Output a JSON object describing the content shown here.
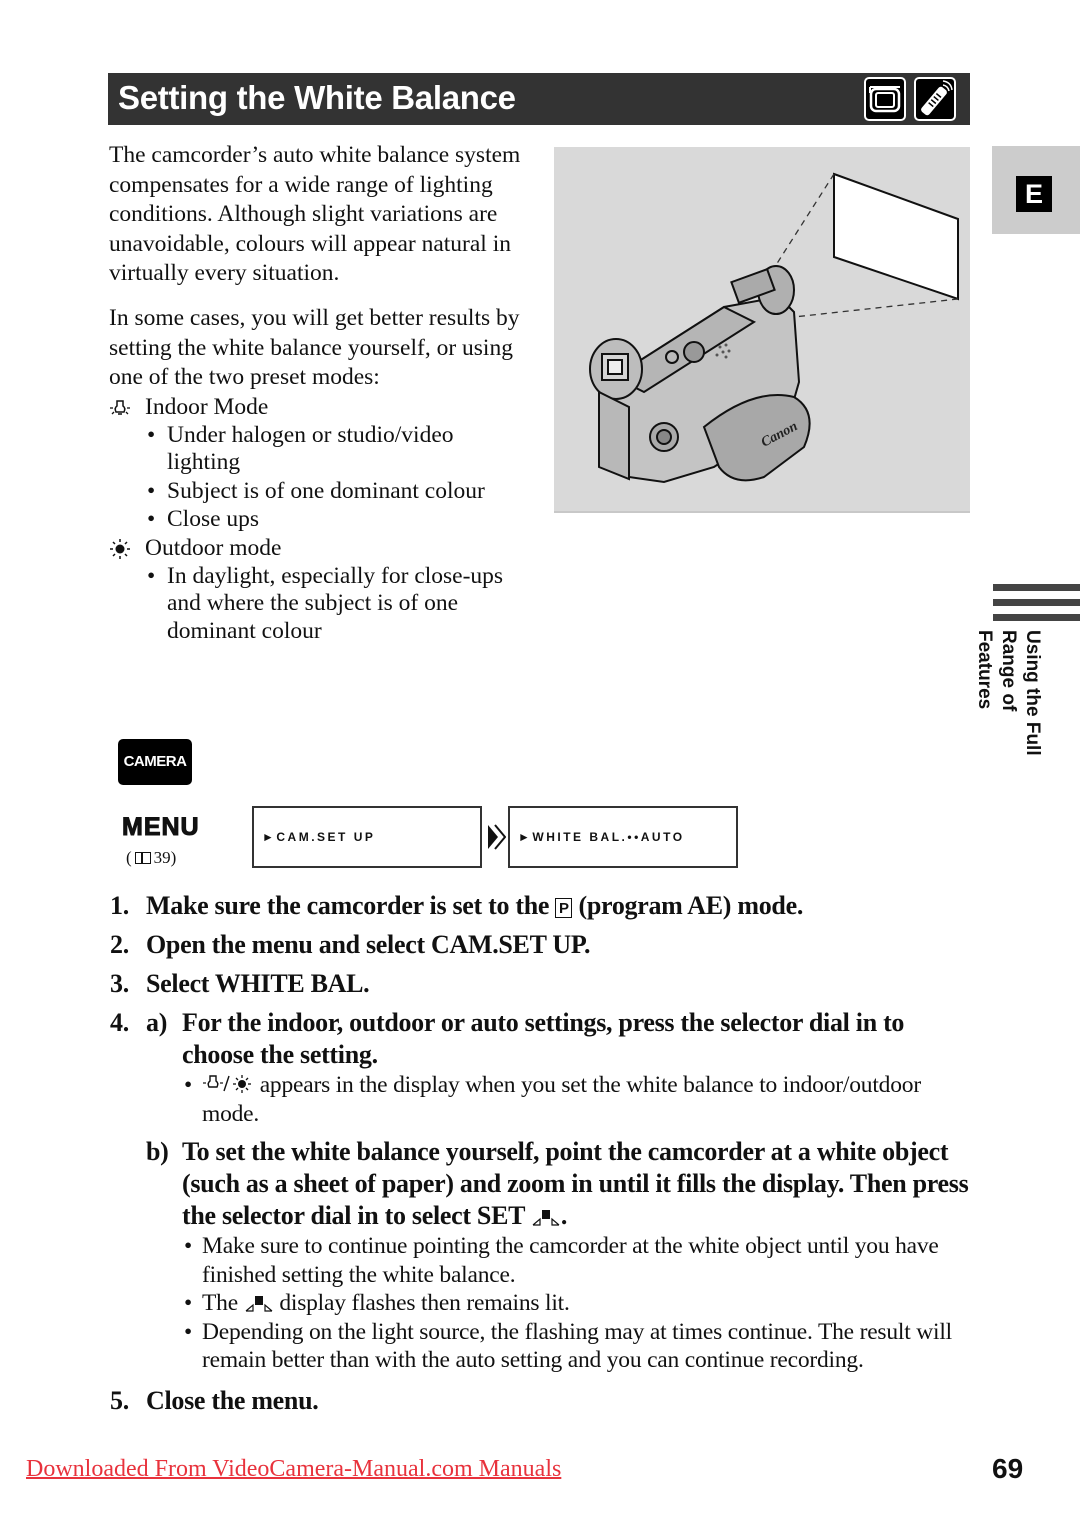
{
  "header": {
    "title": "Setting the White Balance",
    "icons": [
      "camcorder-icon",
      "remote-control-icon"
    ]
  },
  "intro": {
    "paragraph1": "The camcorder’s auto white balance system compensates for a wide range of lighting conditions. Although slight variations are unavoidable, colours will appear natural in virtually every situation.",
    "paragraph2": "In some cases, you will get better results by setting the white balance yourself, or using one of the two preset modes:",
    "modes": [
      {
        "icon": "indoor-bulb-icon",
        "label": "Indoor Mode",
        "items": [
          "Under halogen or studio/video lighting",
          "Subject is of one dominant colour",
          "Close ups"
        ]
      },
      {
        "icon": "outdoor-sun-icon",
        "label": "Outdoor mode",
        "items": [
          "In daylight, especially for close-ups and where the subject is of one dominant colour"
        ]
      }
    ]
  },
  "illustration": {
    "description": "Camcorder pointed at a white sheet of paper",
    "brand_text": "Canon"
  },
  "side_tab": {
    "letter": "E",
    "section_label_line1": "Using the Full",
    "section_label_line2": "Range of Features"
  },
  "menu_panel": {
    "mode_badge": "CAMERA",
    "menu_label": "MENU",
    "page_ref_open": "(",
    "page_ref_number": "39)",
    "screens": [
      "►CAM.SET UP",
      "►WHITE BAL.••AUTO"
    ]
  },
  "steps": [
    {
      "num": "1.",
      "text_before": "Make sure the camcorder is set to the",
      "icon_letter": "P",
      "text_after": "(program AE) mode."
    },
    {
      "num": "2.",
      "text": "Open the menu and select CAM.SET UP."
    },
    {
      "num": "3.",
      "text": "Select WHITE BAL."
    },
    {
      "num": "4.",
      "a_label": "a)",
      "a_text": "For the indoor, outdoor or auto settings, press the selector dial in to choose the setting.",
      "a_note_after_icons": "appears in the display when you set the white balance to indoor/outdoor mode.",
      "b_label": "b)",
      "b_text": "To set the white balance yourself, point the camcorder at a white object (such as a sheet of paper) and zoom in until it fills the display. Then press the selector dial in to select SET",
      "b_text_end": ".",
      "b_notes": {
        "n1": "Make sure to continue pointing the camcorder at the white object until you have finished setting the white balance.",
        "n2_before": "The",
        "n2_after": "display flashes then remains lit.",
        "n3": "Depending on the light source, the flashing may at times continue. The result will remain better than with the auto setting and you can continue recording."
      }
    },
    {
      "num": "5.",
      "text": "Close the menu."
    }
  ],
  "footer": {
    "link_text": "Downloaded From VideoCamera-Manual.com Manuals",
    "page_number": "69",
    "link_color": "#e8323c"
  }
}
